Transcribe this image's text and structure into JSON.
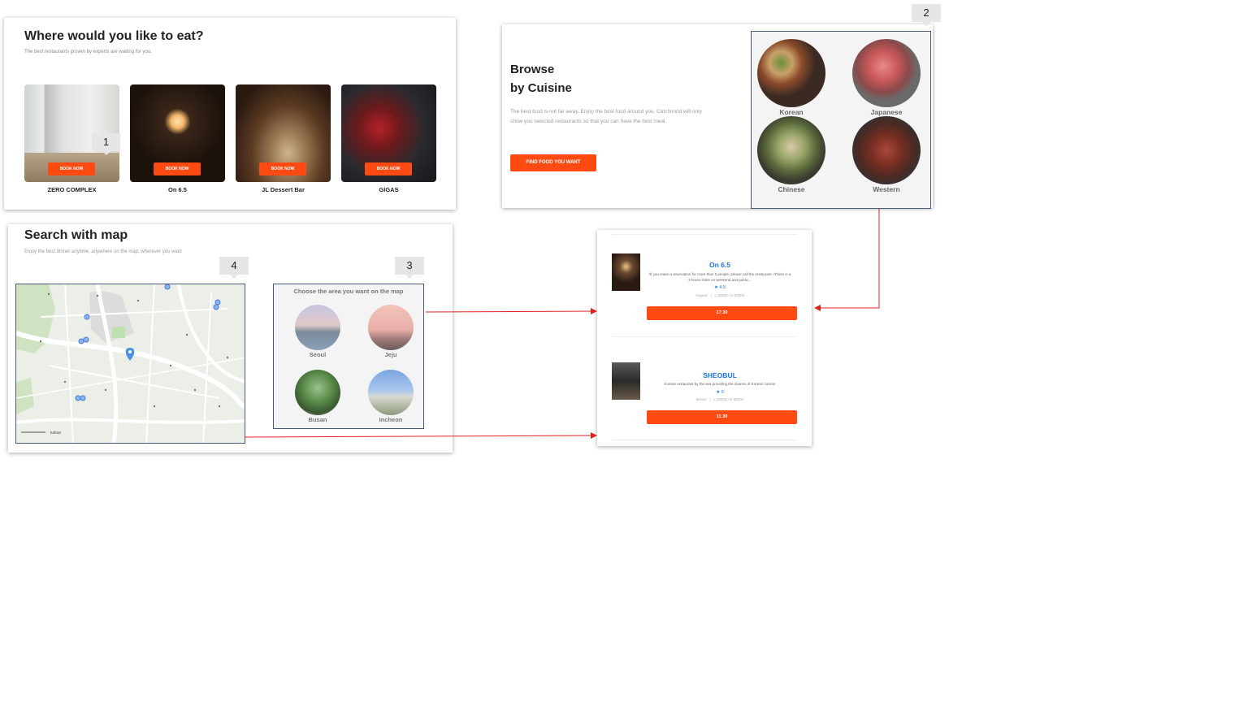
{
  "panel1": {
    "title": "Where would you like to eat?",
    "subtitle": "The best restaurants proven by experts are waiting for you.",
    "book_label": "BOOK NOW",
    "restaurants": [
      {
        "name": "ZERO COMPLEX"
      },
      {
        "name": "On 6.5"
      },
      {
        "name": "JL Dessert Bar"
      },
      {
        "name": "GIGAS"
      }
    ]
  },
  "panel2": {
    "title_line1": "Browse",
    "title_line2": "by Cuisine",
    "description": "The best food is not far away. Enjoy the best food around you. Catchmind will only show you selected restaurants so that you can have the best meal.",
    "button_label": "FIND FOOD YOU WANT",
    "cuisines": [
      {
        "label": "Korean"
      },
      {
        "label": "Japanese"
      },
      {
        "label": "Chinese"
      },
      {
        "label": "Western"
      }
    ]
  },
  "panel3": {
    "title": "Search with map",
    "subtitle": "Enjoy the best dinner anytime, anywhere on the map, wherever you want",
    "area_heading": "Choose the area you want on the map",
    "areas": [
      {
        "label": "Seoul"
      },
      {
        "label": "Jeju"
      },
      {
        "label": "Busan"
      },
      {
        "label": "Incheon"
      }
    ],
    "map_attribution": "kakao"
  },
  "panel4": {
    "results": [
      {
        "name": "On 6.5",
        "description": "/If you make a reservation for more than 5 people, please call the restaurant. /There is a 2 hours limits on weekend and public...",
        "rating": "★ 4.5",
        "location": "Angsuk",
        "price": "L 30000 / D 50000",
        "time": "17:30"
      },
      {
        "name": "SHEOBUL",
        "description": "Korean restaurant by the sea providing the charms of Korean cuisine",
        "rating": "★ 0",
        "location": "Busan",
        "price": "L 38000 / D 98000",
        "time": "11:30"
      }
    ]
  },
  "callouts": {
    "c1": "1",
    "c2": "2",
    "c3": "3",
    "c4": "4"
  },
  "colors": {
    "accent": "#ff4a12",
    "link": "#1b74e4",
    "arrow": "#e02020",
    "frame": "#4a5a7a"
  }
}
